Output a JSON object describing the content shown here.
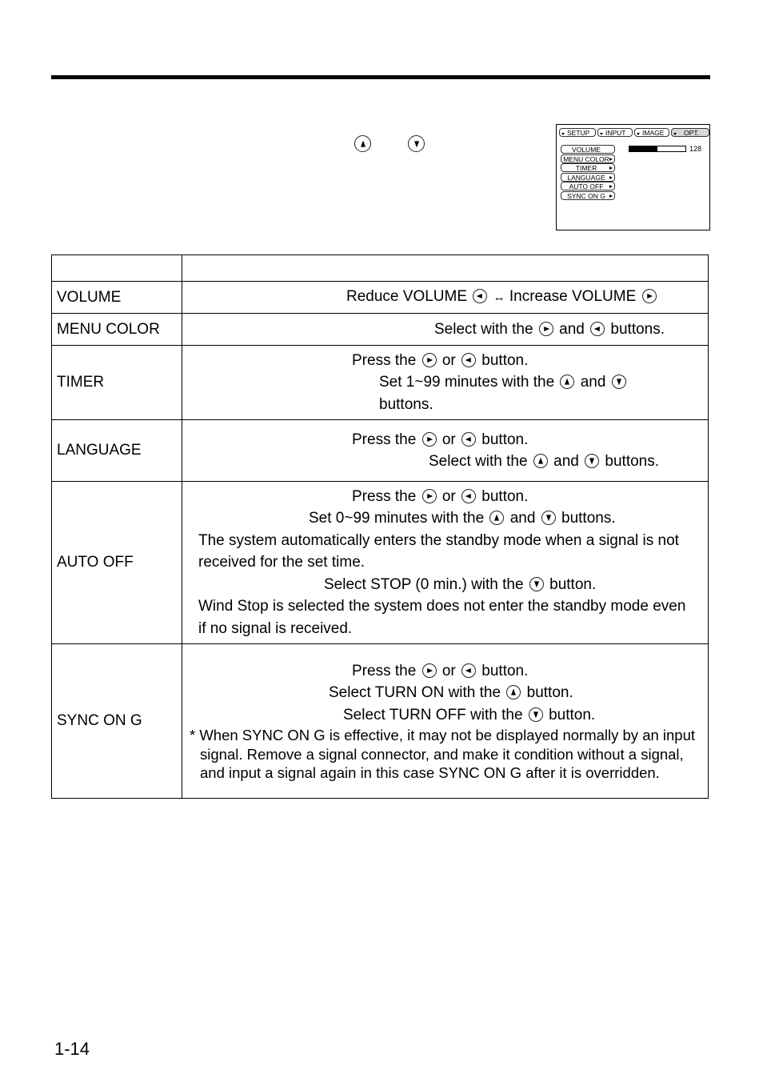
{
  "intro": {
    "icons": [
      "up-button-icon",
      "down-button-icon"
    ]
  },
  "osd_menu": {
    "tabs": [
      {
        "label": "SETUP",
        "active": false
      },
      {
        "label": "INPUT",
        "active": false
      },
      {
        "label": "IMAGE",
        "active": false
      },
      {
        "label": "OPT.",
        "active": true
      }
    ],
    "items": [
      {
        "label": "VOLUME",
        "has_submenu": false
      },
      {
        "label": "MENU COLOR",
        "has_submenu": true
      },
      {
        "label": "TIMER",
        "has_submenu": true
      },
      {
        "label": "LANGUAGE",
        "has_submenu": true
      },
      {
        "label": "AUTO OFF",
        "has_submenu": true
      },
      {
        "label": "SYNC ON G",
        "has_submenu": true
      }
    ],
    "volume_bar_fill_fraction": 0.5,
    "volume_value": "128"
  },
  "table": {
    "header": [
      "",
      ""
    ],
    "rows": [
      {
        "name": "VOLUME",
        "volume_line": {
          "reduce": "Reduce VOLUME",
          "arrow": "↔",
          "increase": "Increase VOLUME"
        }
      },
      {
        "name": "MENU COLOR",
        "line": {
          "a": "Select with the",
          "b": "and",
          "c": "buttons."
        }
      },
      {
        "name": "TIMER",
        "press": {
          "a": "Press the",
          "b": "or",
          "c": "button."
        },
        "set": {
          "a": "Set 1~99 minutes with the",
          "b": "and",
          "c": "buttons."
        }
      },
      {
        "name": "LANGUAGE",
        "press": {
          "a": "Press the",
          "b": "or",
          "c": "button."
        },
        "select": {
          "a": "Select with the",
          "b": "and",
          "c": "buttons."
        }
      },
      {
        "name": "AUTO OFF",
        "press": {
          "a": "Press the",
          "b": "or",
          "c": "button."
        },
        "set": {
          "a": "Set 0~99 minutes with the",
          "b": "and",
          "c": "buttons."
        },
        "desc1": "The system automatically enters the standby mode when a signal is not received for the set time.",
        "stop": {
          "a": "Select STOP (0 min.) with the",
          "b": "button."
        },
        "desc2": "Wind Stop is selected the system does not enter the standby mode even if no signal is received."
      },
      {
        "name": "SYNC ON G",
        "press": {
          "a": "Press the",
          "b": "or",
          "c": "button."
        },
        "on": {
          "a": "Select TURN ON with the",
          "b": "button."
        },
        "off": {
          "a": "Select TURN OFF with the",
          "b": "button."
        },
        "note": "* When SYNC ON G is effective, it may not be displayed normally by an input signal. Remove a signal connector, and make it condition without a signal, and input a signal again in this case SYNC ON G after it is overridden."
      }
    ]
  },
  "page_number": "1-14"
}
